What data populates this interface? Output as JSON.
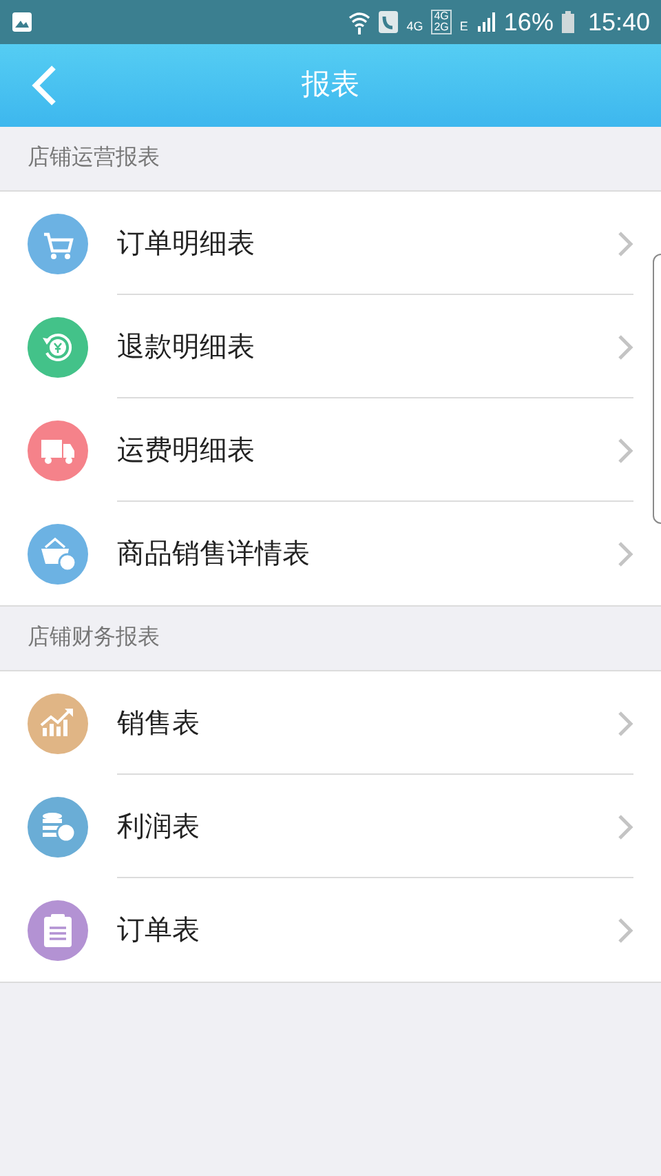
{
  "status_bar": {
    "network_1": "4G",
    "network_2_top": "4G",
    "network_2_bottom": "2G",
    "network_3": "E",
    "battery": "16%",
    "time": "15:40"
  },
  "header": {
    "title": "报表"
  },
  "sections": [
    {
      "title": "店铺运营报表",
      "items": [
        {
          "label": "订单明细表",
          "kind": "cart",
          "color": "#6cb2e3"
        },
        {
          "label": "退款明细表",
          "kind": "refund",
          "color": "#43c289"
        },
        {
          "label": "运费明细表",
          "kind": "truck",
          "color": "#f5828a"
        },
        {
          "label": "商品销售详情表",
          "kind": "basket",
          "color": "#6cb2e3"
        }
      ]
    },
    {
      "title": "店铺财务报表",
      "items": [
        {
          "label": "销售表",
          "kind": "chart",
          "color": "#e0b585"
        },
        {
          "label": "利润表",
          "kind": "coins",
          "color": "#6aadd6"
        },
        {
          "label": "订单表",
          "kind": "clipboard",
          "color": "#b392d3"
        }
      ]
    }
  ]
}
